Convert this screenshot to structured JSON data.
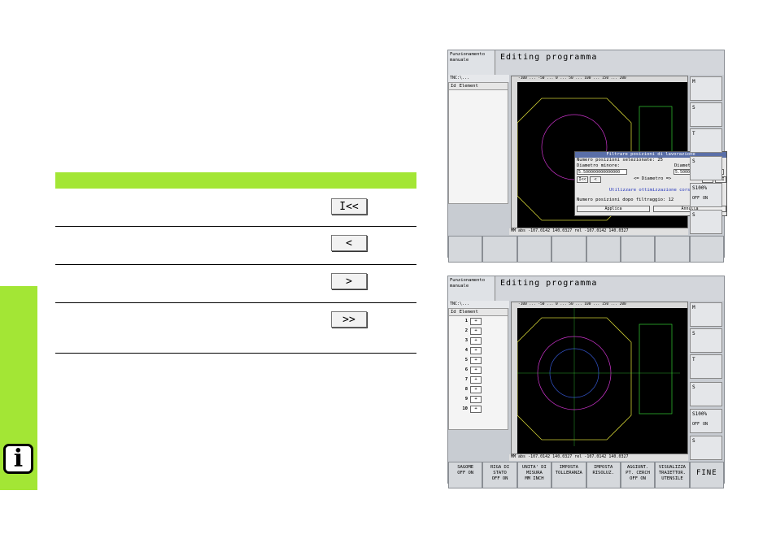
{
  "keys": [
    {
      "label": "I<<"
    },
    {
      "label": "<"
    },
    {
      "label": ">"
    },
    {
      "label": ">>"
    }
  ],
  "info_icon": "i",
  "screen1": {
    "mode": "Funzionamento manuale",
    "title": "Editing programma",
    "path": "TNC:\\...",
    "col_id": "Id",
    "col_element": "Element",
    "ruler": "-100 ... -50 ... 0 ... 50 ... 100 ... 150 ... 200",
    "status": "MM  abs -107.0142 140.0327 rel -107.0142 140.0327",
    "dialog": {
      "title": "Filtrare posizioni di lavorazione",
      "selected": "Numero posizioni selezionate: 25",
      "dia_min_label": "Diametro minore:",
      "dia_max_label": "Diametro maggiore:",
      "dia_min_value": "5.500000000000000",
      "dia_max_value": "5.500000000000000",
      "nav_left_first": "I<<",
      "nav_left_prev": "<",
      "nav_center": "<= Diametro =>",
      "nav_right_next": ">",
      "nav_right_last": ">>I",
      "optimize": "Utilizzare ottimizzazione corsa",
      "after_filter": "Numero posizioni dopo filtraggio: 12",
      "apply": "Applica",
      "cancel": "Annulla"
    },
    "right_buttons": [
      "M",
      "S",
      "T",
      "S",
      "S100%",
      "S"
    ],
    "sbutton_off": "OFF",
    "sbutton_on": "ON"
  },
  "screen2": {
    "mode": "Funzionamento manuale",
    "title": "Editing programma",
    "path": "TNC:\\...",
    "col_id": "Id",
    "col_element": "Element",
    "ruler": "-100 ... -50 ... 0 ... 50 ... 100 ... 150 ... 200",
    "status": "MM  abs -107.0142 140.0327 rel -107.0142 140.0327",
    "items": [
      "1",
      "2",
      "3",
      "4",
      "5",
      "6",
      "7",
      "8",
      "9",
      "10"
    ],
    "item_mark": "+",
    "right_buttons": [
      "M",
      "S",
      "T",
      "S",
      "S100%",
      "S"
    ],
    "sbutton_off": "OFF",
    "sbutton_on": "ON",
    "softkeys": [
      "SAGOME\nOFF  ON",
      "RIGA DI\nSTATO\nOFF  ON",
      "UNITA' DI\nMISURA\nMM  INCH",
      "IMPOSTA\nTOLLERANZA",
      "IMPOSTA\nRISOLUZ.",
      "AGGIUNT.\nPT. CERCH\nOFF  ON",
      "VISUALIZZA\nTRAIETTOR.\nUTENSILE",
      "FINE"
    ]
  }
}
